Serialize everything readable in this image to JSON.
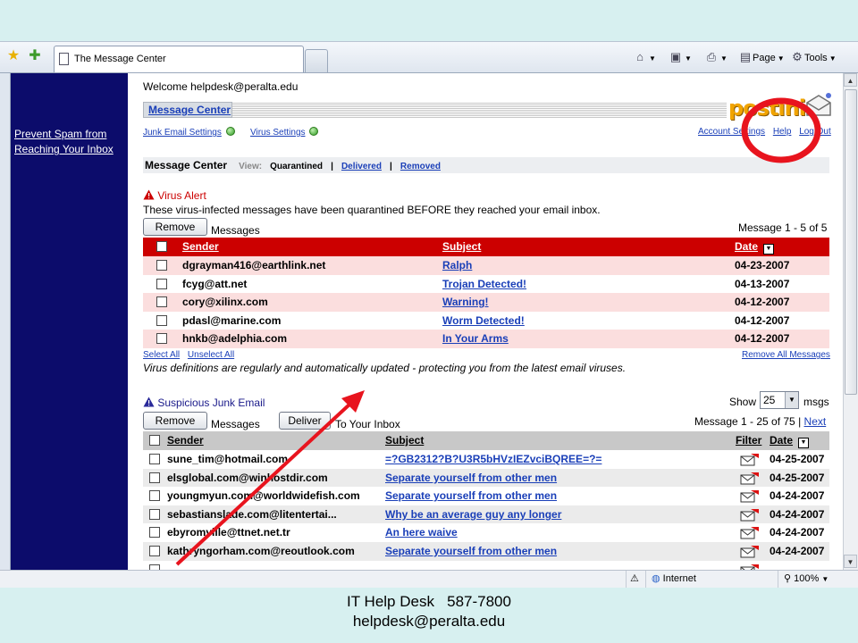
{
  "browser": {
    "tab_title": "The Message Center",
    "toolbar": {
      "page_label": "Page",
      "tools_label": "Tools"
    }
  },
  "sidebar": {
    "link_line1": "Prevent Spam from",
    "link_line2": "Reaching Your Inbox"
  },
  "header": {
    "welcome": "Welcome helpdesk@peralta.edu",
    "message_center_tab": "Message Center",
    "junk_settings": "Junk Email Settings",
    "virus_settings": "Virus Settings",
    "account_settings": "Account Settings",
    "help": "Help",
    "logout": "Log Out",
    "logo_text": "postini"
  },
  "viewbar": {
    "title": "Message Center",
    "view_label": "View:",
    "quarantined": "Quarantined",
    "delivered": "Delivered",
    "removed": "Removed",
    "sep": "|"
  },
  "virus": {
    "title": "Virus Alert",
    "description": "These virus-infected messages have been quarantined BEFORE they reached your email inbox.",
    "remove_button": "Remove",
    "messages_label": "Messages",
    "count": "Message 1 - 5 of 5",
    "col_sender": "Sender",
    "col_subject": "Subject",
    "col_date": "Date",
    "rows": [
      {
        "sender": "dgrayman416@earthlink.net",
        "subject": "Ralph",
        "date": "04-23-2007"
      },
      {
        "sender": "fcyg@att.net",
        "subject": "Trojan Detected!",
        "date": "04-13-2007"
      },
      {
        "sender": "cory@xilinx.com",
        "subject": "Warning!",
        "date": "04-12-2007"
      },
      {
        "sender": "pdasl@marine.com",
        "subject": "Worm Detected!",
        "date": "04-12-2007"
      },
      {
        "sender": "hnkb@adelphia.com",
        "subject": "In Your Arms",
        "date": "04-12-2007"
      }
    ],
    "select_all": "Select All",
    "unselect_all": "Unselect All",
    "remove_all": "Remove All Messages",
    "definitions_note": "Virus definitions are regularly and automatically updated - protecting you from the latest email viruses."
  },
  "junk": {
    "title": "Suspicious Junk Email",
    "show_label": "Show",
    "show_value": "25",
    "msgs_label": "msgs",
    "remove_button": "Remove",
    "messages_label": "Messages",
    "deliver_button": "Deliver",
    "to_inbox_label": "To Your Inbox",
    "count": "Message 1 - 25 of 75 |",
    "next": "Next",
    "col_sender": "Sender",
    "col_subject": "Subject",
    "col_filter": "Filter",
    "col_date": "Date",
    "rows": [
      {
        "sender": "sune_tim@hotmail.com",
        "subject": "=?GB2312?B?U3R5bHVzIEZvciBQREE=?=",
        "date": "04-25-2007"
      },
      {
        "sender": "elsglobal.com@winhostdir.com",
        "subject": "Separate yourself from other men",
        "date": "04-25-2007"
      },
      {
        "sender": "youngmyun.com@worldwidefish.com",
        "subject": "Separate yourself from other men",
        "date": "04-24-2007"
      },
      {
        "sender": "sebastianslade.com@litentertai...",
        "subject": "Why be an average guy any longer",
        "date": "04-24-2007"
      },
      {
        "sender": "ebyromville@ttnet.net.tr",
        "subject": "An here waive",
        "date": "04-24-2007"
      },
      {
        "sender": "kathryngorham.com@reoutlook.com",
        "subject": "Separate yourself from other men",
        "date": "04-24-2007"
      },
      {
        "sender": "",
        "subject": "",
        "date": ""
      }
    ]
  },
  "statusbar": {
    "zone": "Internet",
    "zoom": "100%"
  },
  "caption": {
    "line1": "IT Help Desk   587-7800",
    "line2": "helpdesk@peralta.edu"
  },
  "colors": {
    "sidebar_bg": "#0c0c6b",
    "virus_header": "#cc0000",
    "virus_row": "#fbdede",
    "link": "#1a3fb8",
    "annotation": "#e8141e"
  }
}
